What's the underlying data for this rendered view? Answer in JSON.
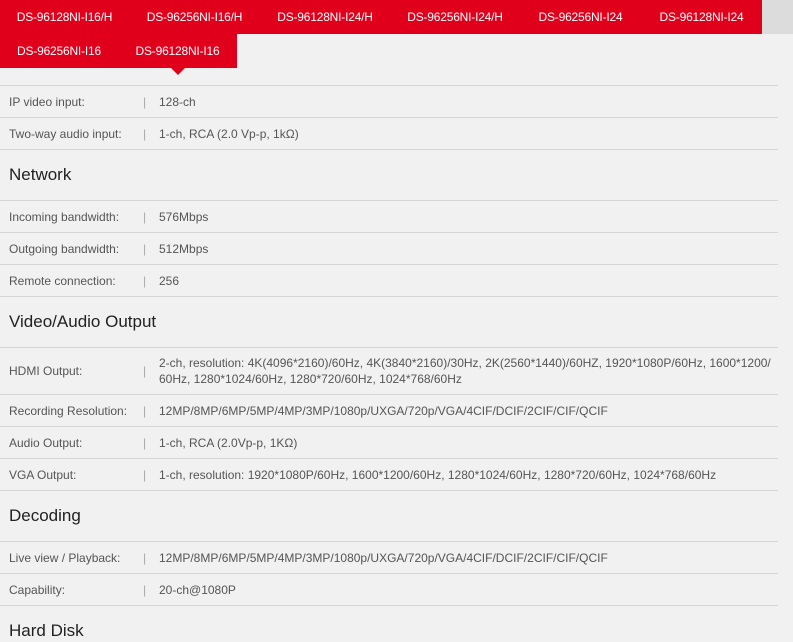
{
  "tabs": {
    "row1": [
      "DS-96128NI-I16/H",
      "DS-96256NI-I16/H",
      "DS-96128NI-I24/H",
      "DS-96256NI-I24/H",
      "DS-96256NI-I24",
      "DS-96128NI-I24"
    ],
    "row2": [
      "DS-96256NI-I16",
      "DS-96128NI-I16"
    ],
    "active": "DS-96128NI-I16"
  },
  "video_audio_input": {
    "ip_video_input": {
      "label": "IP video input:",
      "value": "128-ch"
    },
    "two_way_audio": {
      "label": "Two-way audio input:",
      "value": "1-ch, RCA (2.0 Vp-p, 1kΩ)"
    }
  },
  "network": {
    "title": "Network",
    "incoming": {
      "label": "Incoming bandwidth:",
      "value": "576Mbps"
    },
    "outgoing": {
      "label": "Outgoing bandwidth:",
      "value": "512Mbps"
    },
    "remote": {
      "label": "Remote connection:",
      "value": "256"
    }
  },
  "video_audio_output": {
    "title": "Video/Audio Output",
    "hdmi": {
      "label": "HDMI Output:",
      "value": "2-ch, resolution: 4K(4096*2160)/60Hz, 4K(3840*2160)/30Hz, 2K(2560*1440)/60HZ, 1920*1080P/60Hz, 1600*1200/60Hz, 1280*1024/60Hz, 1280*720/60Hz, 1024*768/60Hz"
    },
    "recording": {
      "label": "Recording Resolution:",
      "value": "12MP/8MP/6MP/5MP/4MP/3MP/1080p/UXGA/720p/VGA/4CIF/DCIF/2CIF/CIF/QCIF"
    },
    "audio": {
      "label": "Audio Output:",
      "value": "1-ch, RCA (2.0Vp-p, 1KΩ)"
    },
    "vga": {
      "label": "VGA Output:",
      "value": "1-ch, resolution: 1920*1080P/60Hz, 1600*1200/60Hz, 1280*1024/60Hz, 1280*720/60Hz, 1024*768/60Hz"
    }
  },
  "decoding": {
    "title": "Decoding",
    "live_view": {
      "label": "Live view / Playback:",
      "value": "12MP/8MP/6MP/5MP/4MP/3MP/1080p/UXGA/720p/VGA/4CIF/DCIF/2CIF/CIF/QCIF"
    },
    "capability": {
      "label": "Capability:",
      "value": "20-ch@1080P"
    }
  },
  "hard_disk": {
    "title": "Hard Disk"
  },
  "separator": "|"
}
